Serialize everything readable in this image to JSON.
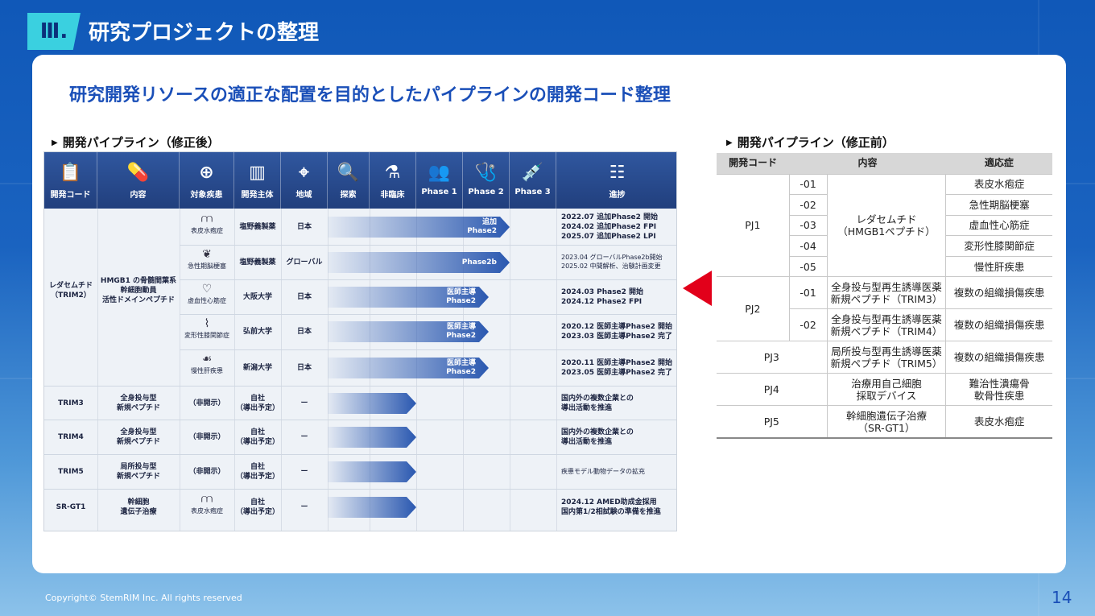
{
  "header": {
    "section_number": "Ⅲ.",
    "section_title": "研究プロジェクトの整理"
  },
  "card": {
    "subtitle": "研究開発リソースの適正な配置を目的としたパイプラインの開発コード整理",
    "left_label": "開発パイプライン（修正後）",
    "right_label": "開発パイプライン（修正前）"
  },
  "pipeline": {
    "headers": [
      "開発コード",
      "内容",
      "対象疾患",
      "開発主体",
      "地域",
      "探索",
      "非臨床",
      "Phase 1",
      "Phase 2",
      "Phase 3",
      "進捗"
    ],
    "trim2": {
      "code": "レダセムチド\n（TRIM2）",
      "content": "HMGB1 の骨髄間葉系\n幹細胞動員\n活性ドメインペプチド",
      "rows": [
        {
          "disease": "表皮水疱症",
          "org": "塩野義製薬",
          "region": "日本",
          "phase": "追加\nPhase2",
          "progress": "2022.07 追加Phase2 開始\n2024.02 追加Phase2 FPI\n2025.07 追加Phase2 LPI"
        },
        {
          "disease": "急性期脳梗塞",
          "org": "塩野義製薬",
          "region": "グローバル",
          "phase": "Phase2b",
          "progress": "2023.04 グローバルPhase2b開始\n2025.02 中間解析、治験計画変更"
        },
        {
          "disease": "虚血性心筋症",
          "org": "大阪大学",
          "region": "日本",
          "phase": "医師主導\nPhase2",
          "progress": "2024.03 Phase2 開始\n2024.12 Phase2 FPI"
        },
        {
          "disease": "変形性膝関節症",
          "org": "弘前大学",
          "region": "日本",
          "phase": "医師主導\nPhase2",
          "progress": "2020.12 医師主導Phase2 開始\n2023.03 医師主導Phase2 完了"
        },
        {
          "disease": "慢性肝疾患",
          "org": "新潟大学",
          "region": "日本",
          "phase": "医師主導\nPhase2",
          "progress": "2020.11 医師主導Phase2 開始\n2023.05 医師主導Phase2 完了"
        }
      ]
    },
    "others": [
      {
        "code": "TRIM3",
        "content": "全身投与型\n新規ペプチド",
        "disease": "（非開示）",
        "org": "自社\n（導出予定）",
        "region": "ー",
        "progress": "国内外の複数企業との\n導出活動を推進"
      },
      {
        "code": "TRIM4",
        "content": "全身投与型\n新規ペプチド",
        "disease": "（非開示）",
        "org": "自社\n（導出予定）",
        "region": "ー",
        "progress": "国内外の複数企業との\n導出活動を推進"
      },
      {
        "code": "TRIM5",
        "content": "局所投与型\n新規ペプチド",
        "disease": "（非開示）",
        "org": "自社\n（導出予定）",
        "region": "ー",
        "progress": "疾患モデル動物データの拡充"
      },
      {
        "code": "SR-GT1",
        "content": "幹細胞\n遺伝子治療",
        "disease": "表皮水疱症",
        "org": "自社\n（導出予定）",
        "region": "ー",
        "progress": "2024.12 AMED助成金採用\n国内第1/2相試験の準備を推進"
      }
    ]
  },
  "old_table": {
    "headers": [
      "開発コード",
      "内容",
      "適応症"
    ],
    "pj1": {
      "code": "PJ1",
      "content": "レダセムチド\n（HMGB1ペプチド）",
      "subs": [
        "-01",
        "-02",
        "-03",
        "-04",
        "-05"
      ],
      "diseases": [
        "表皮水疱症",
        "急性期脳梗塞",
        "虚血性心筋症",
        "変形性膝関節症",
        "慢性肝疾患"
      ]
    },
    "pj2": {
      "code": "PJ2",
      "subs": [
        "-01",
        "-02"
      ],
      "contents": [
        "全身投与型再生誘導医薬\n新規ペプチド（TRIM3）",
        "全身投与型再生誘導医薬\n新規ペプチド（TRIM4）"
      ],
      "diseases": [
        "複数の組織損傷疾患",
        "複数の組織損傷疾患"
      ]
    },
    "pj3": {
      "code": "PJ3",
      "content": "局所投与型再生誘導医薬\n新規ペプチド（TRIM5）",
      "disease": "複数の組織損傷疾患"
    },
    "pj4": {
      "code": "PJ4",
      "content": "治療用自己細胞\n採取デバイス",
      "disease": "難治性潰瘍骨\n軟骨性疾患"
    },
    "pj5": {
      "code": "PJ5",
      "content": "幹細胞遺伝子治療\n（SR-GT1）",
      "disease": "表皮水疱症"
    }
  },
  "footer": {
    "copyright": "Copyright© StemRIM Inc. All rights reserved",
    "page": "14"
  }
}
